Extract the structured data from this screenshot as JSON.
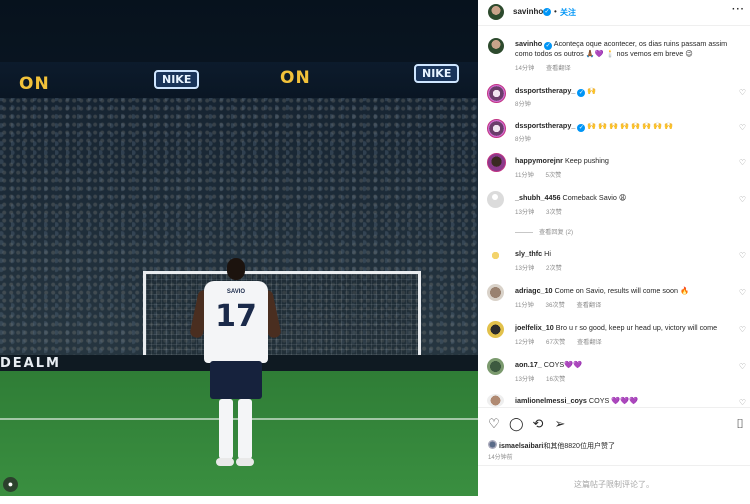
{
  "photo": {
    "led_left": "ON",
    "led_logo": "NIKE",
    "led_right": "ON",
    "led_logo2": "NIKE",
    "shirt_name": "SAVIO",
    "shirt_number": "17",
    "adboard": "DEALM"
  },
  "header": {
    "username": "savinho",
    "separator": "•",
    "follow_label": "关注",
    "more_label": "···"
  },
  "caption": {
    "username": "savinho",
    "text": "Aconteça oque acontecer, os dias ruins passam assim como todos os outros 🙏🏾💜 🕯️ nos vemos em breve 😉",
    "time": "14分钟",
    "translate": "查看翻译"
  },
  "comments": [
    {
      "username": "dssportstherapy_",
      "text": "🙌",
      "time": "8分钟",
      "likes": "",
      "verified": true
    },
    {
      "username": "dssportstherapy_",
      "text": "🙌 🙌 🙌 🙌 🙌 🙌 🙌 🙌",
      "time": "8分钟",
      "likes": "",
      "verified": true
    },
    {
      "username": "happymorejnr",
      "text": "Keep pushing",
      "time": "11分钟",
      "likes": "5次赞"
    },
    {
      "username": "_shubh_4456",
      "text": "Comeback Savio 😩",
      "time": "13分钟",
      "likes": "3次赞",
      "replies": "查看回复 (2)"
    },
    {
      "username": "sly_thfc",
      "text": "Hi",
      "time": "13分钟",
      "likes": "2次赞"
    },
    {
      "username": "adriagc_10",
      "text": "Come on Savio, results will come soon 🔥",
      "time": "11分钟",
      "likes": "36次赞",
      "translate": "查看翻译"
    },
    {
      "username": "joelfelix_10",
      "text": "Bro u r so good, keep ur head up, victory will come",
      "time": "12分钟",
      "likes": "67次赞",
      "translate": "查看翻译"
    },
    {
      "username": "aon.17_",
      "text": "COYS💜💜",
      "time": "13分钟",
      "likes": "16次赞"
    },
    {
      "username": "iamlionelmessi_coys",
      "text": "COYS 💜💜💜",
      "time": "",
      "likes": ""
    }
  ],
  "likes_line": {
    "username": "ismaelsaibari",
    "rest": "和其他8820位用户赞了"
  },
  "post_time": "14分钟前",
  "comments_disabled": "这篇帖子限制评论了。",
  "icons": {
    "like": "heart-icon",
    "comment": "comment-icon",
    "share": "share-icon",
    "send": "send-icon",
    "save": "bookmark-icon"
  },
  "colors": {
    "link": "#0095f6",
    "secondary_text": "#8e8e8e"
  }
}
